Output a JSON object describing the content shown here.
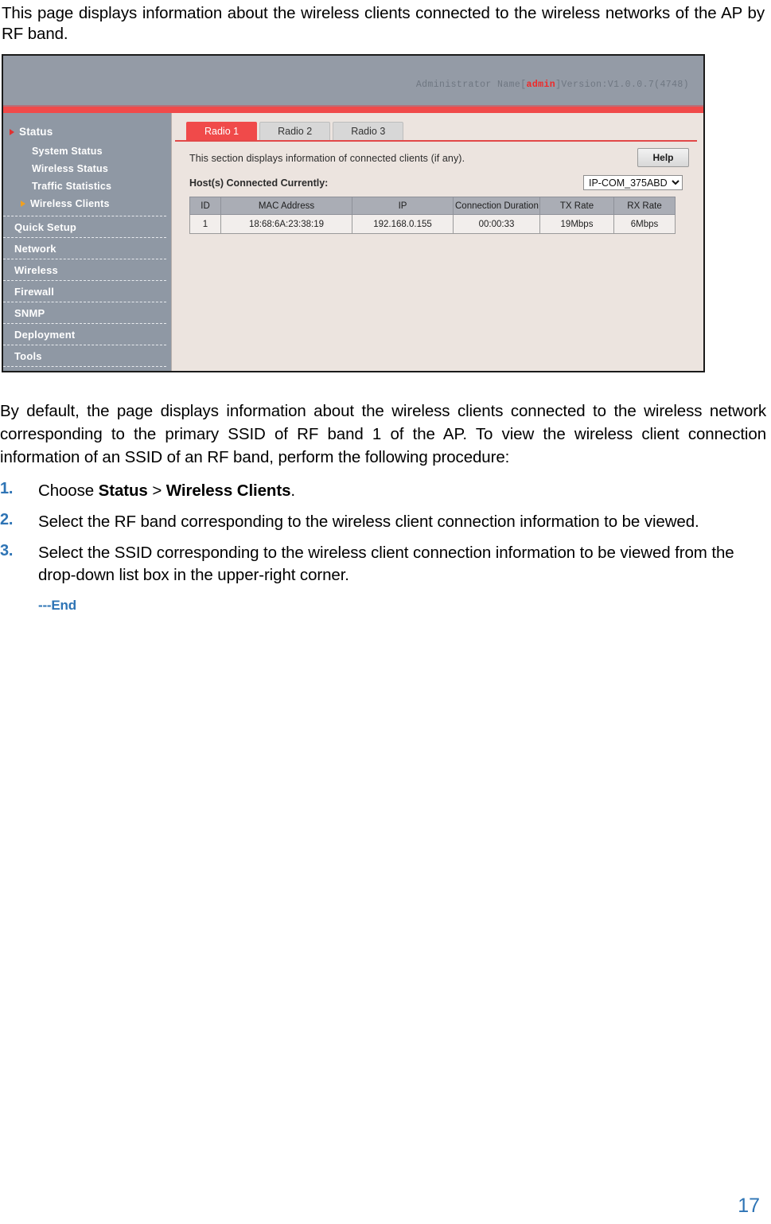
{
  "intro": "This page displays information about the wireless clients connected to the wireless networks of the AP by RF band.",
  "screenshot": {
    "header": {
      "admin_prefix": "Administrator Name[",
      "admin_name": "admin",
      "admin_suffix": "]Version:V1.0.0.7(4748)"
    },
    "sidebar": {
      "items": [
        {
          "label": "Status",
          "type": "top"
        },
        {
          "label": "System Status",
          "type": "sub"
        },
        {
          "label": "Wireless Status",
          "type": "sub"
        },
        {
          "label": "Traffic Statistics",
          "type": "sub"
        },
        {
          "label": "Wireless Clients",
          "type": "sub-current"
        },
        {
          "label": "Quick Setup",
          "type": "item"
        },
        {
          "label": "Network",
          "type": "item"
        },
        {
          "label": "Wireless",
          "type": "item"
        },
        {
          "label": "Firewall",
          "type": "item"
        },
        {
          "label": "SNMP",
          "type": "item"
        },
        {
          "label": "Deployment",
          "type": "item"
        },
        {
          "label": "Tools",
          "type": "item"
        }
      ]
    },
    "tabs": [
      {
        "label": "Radio 1",
        "active": true
      },
      {
        "label": "Radio 2",
        "active": false
      },
      {
        "label": "Radio 3",
        "active": false
      }
    ],
    "panel": {
      "description": "This section displays information of connected clients (if any).",
      "help_label": "Help",
      "host_label": "Host(s) Connected Currently:",
      "ssid_selected": "IP-COM_375ABD",
      "ssid_options": [
        "IP-COM_375ABD"
      ],
      "table": {
        "headers": [
          "ID",
          "MAC Address",
          "IP",
          "Connection Duration",
          "TX Rate",
          "RX Rate"
        ],
        "rows": [
          {
            "id": "1",
            "mac": "18:68:6A:23:38:19",
            "ip": "192.168.0.155",
            "duration": "00:00:33",
            "tx_rate": "19Mbps",
            "rx_rate": "6Mbps"
          }
        ]
      }
    }
  },
  "body": {
    "paragraph": "By default, the page displays information about the wireless clients connected to the wireless network corresponding to the primary SSID of RF band 1 of the AP. To view the wireless client connection information of an SSID of an RF band, perform the following procedure:",
    "steps": [
      {
        "num": "1.",
        "pre": "Choose ",
        "bold1": "Status",
        "mid": " > ",
        "bold2": "Wireless Clients",
        "post": "."
      },
      {
        "num": "2.",
        "pre": "Select the RF band corresponding to the wireless client connection information to be viewed.",
        "bold1": "",
        "mid": "",
        "bold2": "",
        "post": ""
      },
      {
        "num": "3.",
        "pre": "Select the SSID corresponding to the wireless client connection information to be viewed from the drop-down list box in the upper-right corner.",
        "bold1": "",
        "mid": "",
        "bold2": "",
        "post": ""
      }
    ],
    "end_mark": "---End"
  },
  "page_number": "17",
  "colors": {
    "accent_red": "#f04a4a",
    "sidebar_gray": "#8f98a4",
    "content_beige": "#ece4df",
    "table_header_gray": "#aaadb5",
    "link_blue": "#2e74b5"
  }
}
